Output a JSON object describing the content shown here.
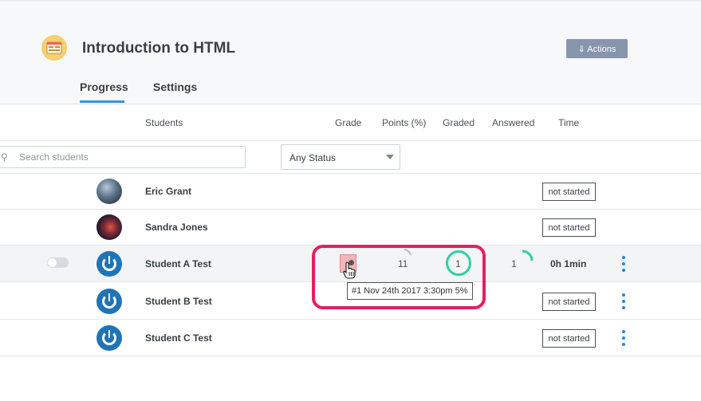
{
  "header": {
    "course_title": "Introduction to HTML",
    "actions_label": "⇓ Actions",
    "course_icon": "course-icon"
  },
  "tabs": [
    {
      "label": "Progress",
      "active": true
    },
    {
      "label": "Settings",
      "active": false
    }
  ],
  "table": {
    "columns": [
      "Students",
      "Grade",
      "Points (%)",
      "Graded",
      "Answered",
      "Time"
    ]
  },
  "filters": {
    "search_placeholder": "Search students",
    "status_value": "Any Status"
  },
  "students": [
    {
      "name": "Eric Grant",
      "status": "not started"
    },
    {
      "name": "Sandra Jones",
      "status": "not started"
    },
    {
      "name": "Student A Test",
      "points": "11",
      "graded": "1",
      "answered": "1",
      "time": "0h 1min",
      "tooltip": "#1 Nov 24th 2017 3:30pm 5%"
    },
    {
      "name": "Student B Test",
      "status": "not started"
    },
    {
      "name": "Student C Test",
      "status": "not started"
    }
  ],
  "colors": {
    "accent": "#2d9be3",
    "actions_button": "#8795ad",
    "highlight": "#e81e5e",
    "graded_ring": "#2fd0a4",
    "kebab": "#1e88e5",
    "grade_cell": "#f2b6b9"
  }
}
